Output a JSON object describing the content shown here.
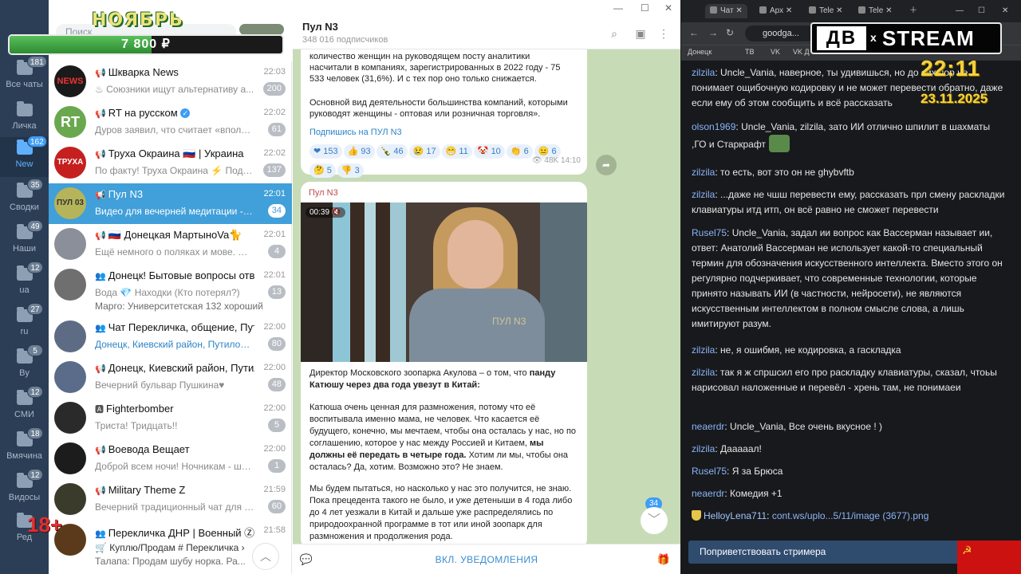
{
  "telegram": {
    "promo": {
      "month": "НОЯБРЬ",
      "amount": "7 800 ₽",
      "progress": 0.52
    },
    "search_placeholder": "Поиск",
    "folders": [
      {
        "label": "Все чаты",
        "badge": "181"
      },
      {
        "label": "Личка",
        "badge": ""
      },
      {
        "label": "New",
        "badge": "162"
      },
      {
        "label": "Сводки",
        "badge": "35"
      },
      {
        "label": "Наши",
        "badge": "49"
      },
      {
        "label": "ua",
        "badge": "12"
      },
      {
        "label": "ru",
        "badge": "27"
      },
      {
        "label": "By",
        "badge": "5"
      },
      {
        "label": "СМИ",
        "badge": "12"
      },
      {
        "label": "Вмячина",
        "badge": "18"
      },
      {
        "label": "Видосы",
        "badge": "12"
      },
      {
        "label": "Ред",
        "badge": ""
      }
    ],
    "age_mark": "18+",
    "chats": [
      {
        "name": "Шкварка News",
        "time": "22:03",
        "preview": "♨ Союзники ищут альтернативу а...",
        "badge": "200",
        "avatar_text": "NEWS",
        "avatar_color": "#1a1a1a"
      },
      {
        "name": "RT на русском",
        "time": "22:02",
        "preview": "Дуров заявил, что считает «вполне ...",
        "badge": "61",
        "avatar_text": "RT",
        "avatar_color": "#6aa84f"
      },
      {
        "name": "Труха Окраина 🇷🇺 | Украина",
        "time": "22:02",
        "preview": "По факту! Труха Окраина ⚡ Подп...",
        "badge": "137",
        "avatar_text": "ТРУХА",
        "avatar_color": "#c61f1f"
      },
      {
        "name": "Пул N3",
        "time": "22:01",
        "preview": "Видео для вечерней медитации - се...",
        "badge": "34",
        "avatar_text": "ПУЛ 03",
        "avatar_color": "#b6b45a"
      },
      {
        "name": "🇷🇺 Донецкая МартыноVa🐈",
        "time": "22:01",
        "preview": "Ещё немного о поляках и мове. Наве...",
        "badge": "4",
        "avatar_text": "",
        "avatar_color": "#8a8f99"
      },
      {
        "name": "Донецк! Бытовые вопросы ответы:",
        "time": "22:01",
        "preview": "Вода   💎 Находки (Кто потерял?)",
        "preview2": "Марго: Университетская 132 хороший ...",
        "badge": "13",
        "avatar_text": "",
        "avatar_color": "#6f6f6f"
      },
      {
        "name": "Чат Перекличка, общение, Путил...",
        "time": "22:00",
        "preview": "Донецк, Киевский район, Путиловка♥:",
        "badge": "80",
        "avatar_text": "",
        "avatar_color": "#5d6b84"
      },
      {
        "name": "Донецк, Киевский район, Путило...",
        "time": "22:00",
        "preview": "Вечерний бульвар Пушкина♥",
        "badge": "48",
        "avatar_text": "",
        "avatar_color": "#5a6c8a"
      },
      {
        "name": "Fighterbomber",
        "time": "22:00",
        "preview": "Триста!          Тридцать!!",
        "badge": "5",
        "avatar_text": "",
        "avatar_color": "#2a2a2a"
      },
      {
        "name": "Воевода Вещает",
        "time": "22:00",
        "preview": "Доброй всем ночи! Ночникам - штат...",
        "badge": "1",
        "avatar_text": "",
        "avatar_color": "#1c1c1c"
      },
      {
        "name": "Military Theme Z",
        "time": "21:59",
        "preview": "Вечерний традиционный чат для по...",
        "badge": "60",
        "avatar_text": "",
        "avatar_color": "#3b3b2c"
      },
      {
        "name": "Перекличка ДНР | Военный Ⓩ До...",
        "time": "21:58",
        "preview": "🛒 Куплю/Продам  # Перекличка ›",
        "preview2": "Талапа: Продам шубу норка. Ра...",
        "badge": "",
        "avatar_text": "",
        "avatar_color": "#5a3a1a"
      }
    ],
    "header": {
      "title": "Пул N3",
      "subtitle": "348 016 подписчиков"
    },
    "message1": {
      "lines": [
        "количество женщин на руководящем посту аналитики",
        "насчитали в компаниях, зарегистрированных в 2022 году - 75",
        "533 человек (31,6%). И с тех пор оно только снижается.",
        "Основной вид деятельности большинства компаний, которыми",
        "руководят женщины - оптовая или розничная торговля»."
      ],
      "subscribe": "Подпишись на ПУЛ N3",
      "reactions": [
        "❤ 153",
        "👍 93",
        "🍾 46",
        "😢 17",
        "😁 11",
        "🤡 10",
        "👏 6",
        "😐 6",
        "🤔 5",
        "👎 3"
      ],
      "views": "👁 48K  14:10"
    },
    "message2": {
      "sender": "Пул N3",
      "video_time": "00:39 🔇",
      "watermark": "ПУЛ N3",
      "p1": "Директор Московского зоопарка Акулова – о том, что",
      "p1b": "панду",
      "p1c": "Катюшу через два года увезут в Китай:",
      "p2": "Катюша очень ценная для размножения, потому что её воспитывала именно мама, не человек. Что касается её будущего, конечно, мы мечтаем, чтобы она осталась у нас, но по соглашению, которое у нас между Россией и Китаем,",
      "p2b": "мы должны её передать в четыре года.",
      "p2c": "Хотим ли мы, чтобы она осталась? Да, хотим. Возможно это? Не знаем.",
      "p3": "Мы будем пытаться, но насколько у нас это получится, не знаю. Пока прецедента такого не было, и уже детеныши в 4 года либо до 4 лет уезжали в Китай и дальше уже распределялись по природоохранной программе в тот или иной зоопарк для размножения и продолжения рода."
    },
    "unread_count": "34",
    "notif_button": "ВКЛ. УВЕДОМЛЕНИЯ"
  },
  "browser": {
    "tabs": [
      "Чат",
      "Арх",
      "Tele",
      "Tele"
    ],
    "url": "goodga...",
    "bookmarks": [
      "Донецк",
      "ТВ",
      "VK",
      "VK Д"
    ],
    "logo_left": "ДВ",
    "logo_x": "x",
    "logo_right": "STREAM",
    "clock": "22:11",
    "date": "23.11.2025",
    "greet_button": "Поприветствовать стримера",
    "messages": [
      {
        "user": "zilzila",
        "text": "Uncle_Vania, наверное, ты удивишься, но до сих пор не понимает ощибочную кодировку и не может перевести обратно, даже если ему об этом сообщить и всё рассказать"
      },
      {
        "user": "olson1969",
        "text": "Uncle_Vania, zilzila, зато ИИ отлично шпилит в шахматы ,ГО и Старкрафт"
      },
      {
        "user": "zilzila",
        "text": "то есть, вот это он не ghybvftb"
      },
      {
        "user": "zilzila",
        "text": "...даже не чшш перевести ему, рассказать прл смену раскладки клавиатуры итд итп, он всё равно не сможет перевести"
      },
      {
        "user": "Rusel75",
        "text": "Uncle_Vania, задал ии вопрос как Вассерман называет ии, ответ: Анатолий Вассерман не использует какой-то специальный термин для обозначения искусственного интеллекта. Вместо этого он регулярно подчеркивает, что современные технологии, которые принято называть ИИ (в частности, нейросети), не являются искусственным интеллектом в полном смысле слова, а лишь имитируют разум."
      },
      {
        "user": "zilzila",
        "text": "не, я ошибмя, не кодировка, а гаскладка"
      },
      {
        "user": "zilzila",
        "text": "так я ж спршсил его про раскладку клавиатуры, сказал, чтоьы нарисовал наложенные и перевёл - хрень там, не понимаеи"
      },
      {
        "user": "neaerdr",
        "text": "Uncle_Vania, Все очень вкусное ! )"
      },
      {
        "user": "zilzila",
        "text": "Дааааал!"
      },
      {
        "user": "Rusel75",
        "text": "Я за Брюса"
      },
      {
        "user": "neaerdr",
        "text": "Комедия +1"
      },
      {
        "user": "HelloyLena711",
        "text": "cont.ws/uplo...5/11/image (3677).png"
      }
    ]
  }
}
